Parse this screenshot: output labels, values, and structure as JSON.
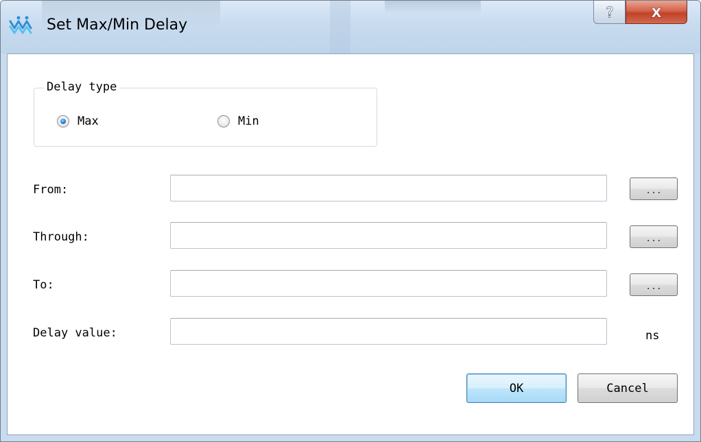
{
  "window": {
    "title": "Set Max/Min Delay",
    "help_glyph": "?",
    "close_glyph": "X"
  },
  "delay_type": {
    "group_label": "Delay type",
    "options": [
      {
        "label": "Max",
        "checked": true
      },
      {
        "label": "Min",
        "checked": false
      }
    ]
  },
  "fields": {
    "from": {
      "label": "From:",
      "value": "",
      "browse_label": "..."
    },
    "through": {
      "label": "Through:",
      "value": "",
      "browse_label": "..."
    },
    "to": {
      "label": "To:",
      "value": "",
      "browse_label": "..."
    },
    "delay_value": {
      "label": "Delay value:",
      "value": "",
      "unit": "ns"
    }
  },
  "buttons": {
    "ok": "OK",
    "cancel": "Cancel"
  },
  "colors": {
    "titlebar": "#c8dbef",
    "close_button": "#c2412a",
    "ok_border": "#3c7fb1",
    "radio_accent": "#2a7fd6"
  },
  "icons": {
    "app": "gowin-logo-icon",
    "help": "question-mark-icon",
    "close": "close-x-icon"
  }
}
